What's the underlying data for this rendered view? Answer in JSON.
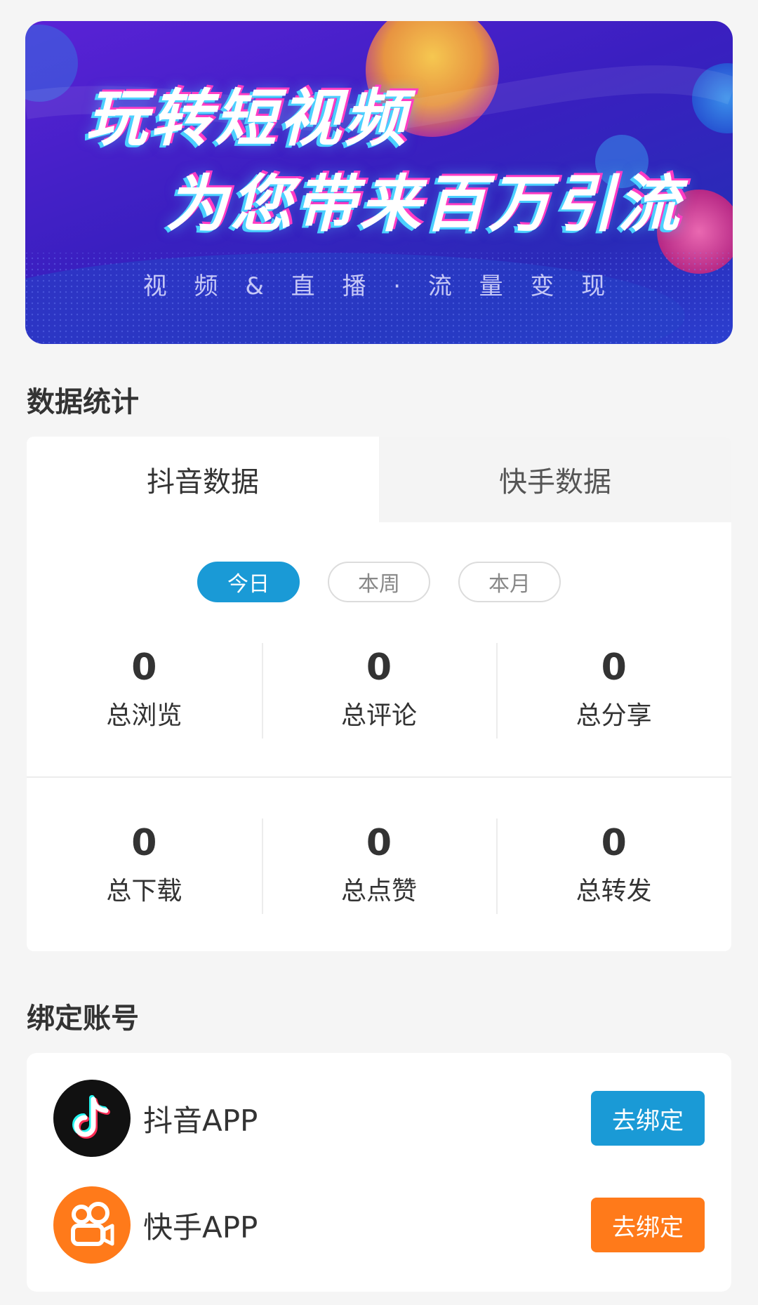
{
  "banner": {
    "headline_1": "玩转短视频",
    "headline_2": "为您带来百万引流",
    "tagline": "视 频 & 直 播 · 流 量 变 现"
  },
  "stats": {
    "section_title": "数据统计",
    "tabs": [
      {
        "label": "抖音数据",
        "active": true
      },
      {
        "label": "快手数据",
        "active": false
      }
    ],
    "periods": [
      {
        "label": "今日",
        "active": true
      },
      {
        "label": "本周",
        "active": false
      },
      {
        "label": "本月",
        "active": false
      }
    ],
    "metrics": [
      {
        "value": "0",
        "label": "总浏览"
      },
      {
        "value": "0",
        "label": "总评论"
      },
      {
        "value": "0",
        "label": "总分享"
      },
      {
        "value": "0",
        "label": "总下载"
      },
      {
        "value": "0",
        "label": "总点赞"
      },
      {
        "value": "0",
        "label": "总转发"
      }
    ]
  },
  "bind": {
    "section_title": "绑定账号",
    "accounts": [
      {
        "name": "抖音APP",
        "icon": "douyin-icon",
        "button": "去绑定",
        "button_color": "#1a9ad6"
      },
      {
        "name": "快手APP",
        "icon": "kuaishou-icon",
        "button": "去绑定",
        "button_color": "#ff7a1a"
      }
    ]
  },
  "colors": {
    "accent_blue": "#1a9ad6",
    "accent_orange": "#ff7a1a",
    "page_bg": "#f5f5f5"
  }
}
